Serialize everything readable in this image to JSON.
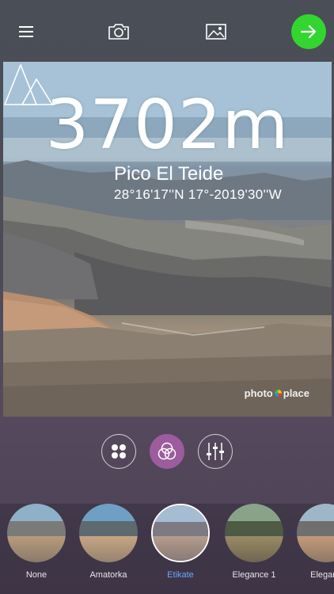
{
  "topbar": {
    "menu_icon": "hamburger-menu-icon",
    "camera_icon": "camera-icon",
    "gallery_icon": "image-icon",
    "next_icon": "arrow-right-icon",
    "next_color": "#33d62f"
  },
  "overlay": {
    "altitude": "3702m",
    "place_name": "Pico El Teide",
    "coordinates": "28°16'17''N 17°-2019'30''W",
    "watermark_left": "photo",
    "watermark_right": "place"
  },
  "modes": {
    "items": [
      {
        "name": "overlays",
        "icon": "grid-dots-icon",
        "selected": false
      },
      {
        "name": "filters",
        "icon": "color-circles-icon",
        "selected": true
      },
      {
        "name": "adjust",
        "icon": "sliders-icon",
        "selected": false
      }
    ],
    "accent": "#9c5c9d"
  },
  "filters": {
    "items": [
      {
        "label": "None",
        "selected": false
      },
      {
        "label": "Amatorka",
        "selected": false
      },
      {
        "label": "Etikate",
        "selected": true
      },
      {
        "label": "Elegance 1",
        "selected": false
      },
      {
        "label": "Eleganc",
        "selected": false
      }
    ],
    "selected_color": "#6aa8ff"
  }
}
